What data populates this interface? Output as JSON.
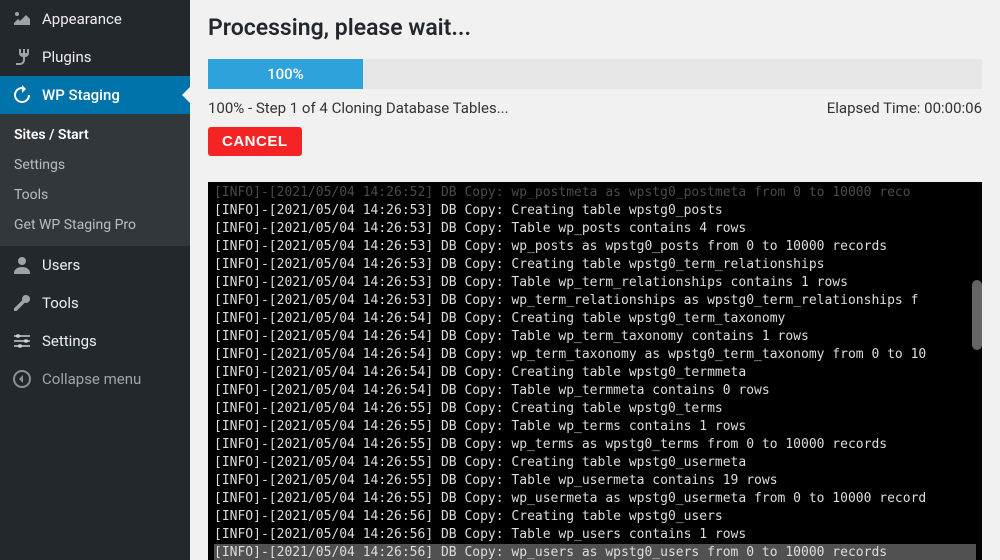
{
  "sidebar": {
    "items": [
      {
        "label": "Appearance",
        "icon": "appearance"
      },
      {
        "label": "Plugins",
        "icon": "plugins"
      },
      {
        "label": "WP Staging",
        "icon": "staging",
        "current": true
      },
      {
        "label": "Users",
        "icon": "users"
      },
      {
        "label": "Tools",
        "icon": "tools"
      },
      {
        "label": "Settings",
        "icon": "settings"
      },
      {
        "label": "Collapse menu",
        "icon": "collapse"
      }
    ],
    "submenu": [
      {
        "label": "Sites / Start",
        "current": true
      },
      {
        "label": "Settings"
      },
      {
        "label": "Tools"
      },
      {
        "label": "Get WP Staging Pro"
      }
    ]
  },
  "page": {
    "title": "Processing, please wait...",
    "progress_label": "100%",
    "progress_pct": 20,
    "status_left": "100% - Step 1 of 4 Cloning Database Tables...",
    "status_right": "Elapsed Time: 00:00:06",
    "cancel_label": "CANCEL"
  },
  "log": {
    "top_clip": "[INFO]-[2021/05/04 14:26:52] DB Copy: wp_postmeta as wpstg0_postmeta from 0 to 10000 reco",
    "lines": [
      "[INFO]-[2021/05/04 14:26:53] DB Copy: Creating table wpstg0_posts",
      "[INFO]-[2021/05/04 14:26:53] DB Copy: Table wp_posts contains 4 rows",
      "[INFO]-[2021/05/04 14:26:53] DB Copy: wp_posts as wpstg0_posts from 0 to 10000 records",
      "[INFO]-[2021/05/04 14:26:53] DB Copy: Creating table wpstg0_term_relationships",
      "[INFO]-[2021/05/04 14:26:53] DB Copy: Table wp_term_relationships contains 1 rows",
      "[INFO]-[2021/05/04 14:26:53] DB Copy: wp_term_relationships as wpstg0_term_relationships f",
      "[INFO]-[2021/05/04 14:26:54] DB Copy: Creating table wpstg0_term_taxonomy",
      "[INFO]-[2021/05/04 14:26:54] DB Copy: Table wp_term_taxonomy contains 1 rows",
      "[INFO]-[2021/05/04 14:26:54] DB Copy: wp_term_taxonomy as wpstg0_term_taxonomy from 0 to 10",
      "[INFO]-[2021/05/04 14:26:54] DB Copy: Creating table wpstg0_termmeta",
      "[INFO]-[2021/05/04 14:26:54] DB Copy: Table wp_termmeta contains 0 rows",
      "[INFO]-[2021/05/04 14:26:55] DB Copy: Creating table wpstg0_terms",
      "[INFO]-[2021/05/04 14:26:55] DB Copy: Table wp_terms contains 1 rows",
      "[INFO]-[2021/05/04 14:26:55] DB Copy: wp_terms as wpstg0_terms from 0 to 10000 records",
      "[INFO]-[2021/05/04 14:26:55] DB Copy: Creating table wpstg0_usermeta",
      "[INFO]-[2021/05/04 14:26:55] DB Copy: Table wp_usermeta contains 19 rows",
      "[INFO]-[2021/05/04 14:26:55] DB Copy: wp_usermeta as wpstg0_usermeta from 0 to 10000 record",
      "[INFO]-[2021/05/04 14:26:56] DB Copy: Creating table wpstg0_users",
      "[INFO]-[2021/05/04 14:26:56] DB Copy: Table wp_users contains 1 rows",
      "[INFO]-[2021/05/04 14:26:56] DB Copy: wp_users as wpstg0_users from 0 to 10000 records"
    ],
    "highlight_index": 19
  }
}
